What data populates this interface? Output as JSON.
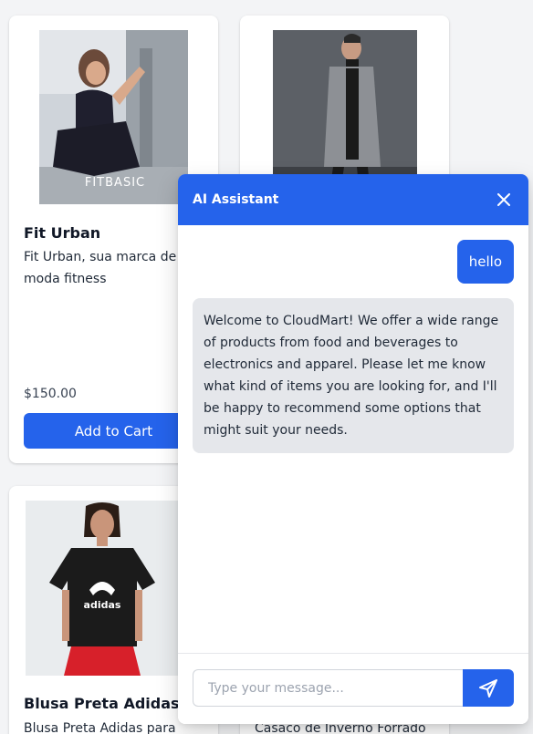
{
  "products": [
    {
      "title": "Fit Urban",
      "description": "Fit Urban, sua marca de moda fitness",
      "price": "$150.00",
      "cart_label": "Add to Cart",
      "image_brand": "FITBASIC"
    },
    {
      "title": "",
      "description": ""
    },
    {
      "title": "Blusa Preta Adidas",
      "description": "Blusa Preta Adidas para",
      "image_brand": "adidas"
    },
    {
      "title": "",
      "description": "Casaco de Inverno Forrado"
    }
  ],
  "chat": {
    "title": "AI Assistant",
    "messages": [
      {
        "role": "user",
        "text": "hello"
      },
      {
        "role": "assistant",
        "text": "Welcome to CloudMart! We offer a wide range of products from food and beverages to electronics and apparel. Please let me know what kind of items you are looking for, and I'll be happy to recommend some options that might suit your needs."
      }
    ],
    "input_placeholder": "Type your message...",
    "input_value": ""
  },
  "colors": {
    "accent": "#2563eb",
    "page_bg": "#f3f4f6",
    "bot_bubble": "#e5e7eb"
  },
  "icons": {
    "close": "close-icon",
    "send": "send-icon"
  }
}
